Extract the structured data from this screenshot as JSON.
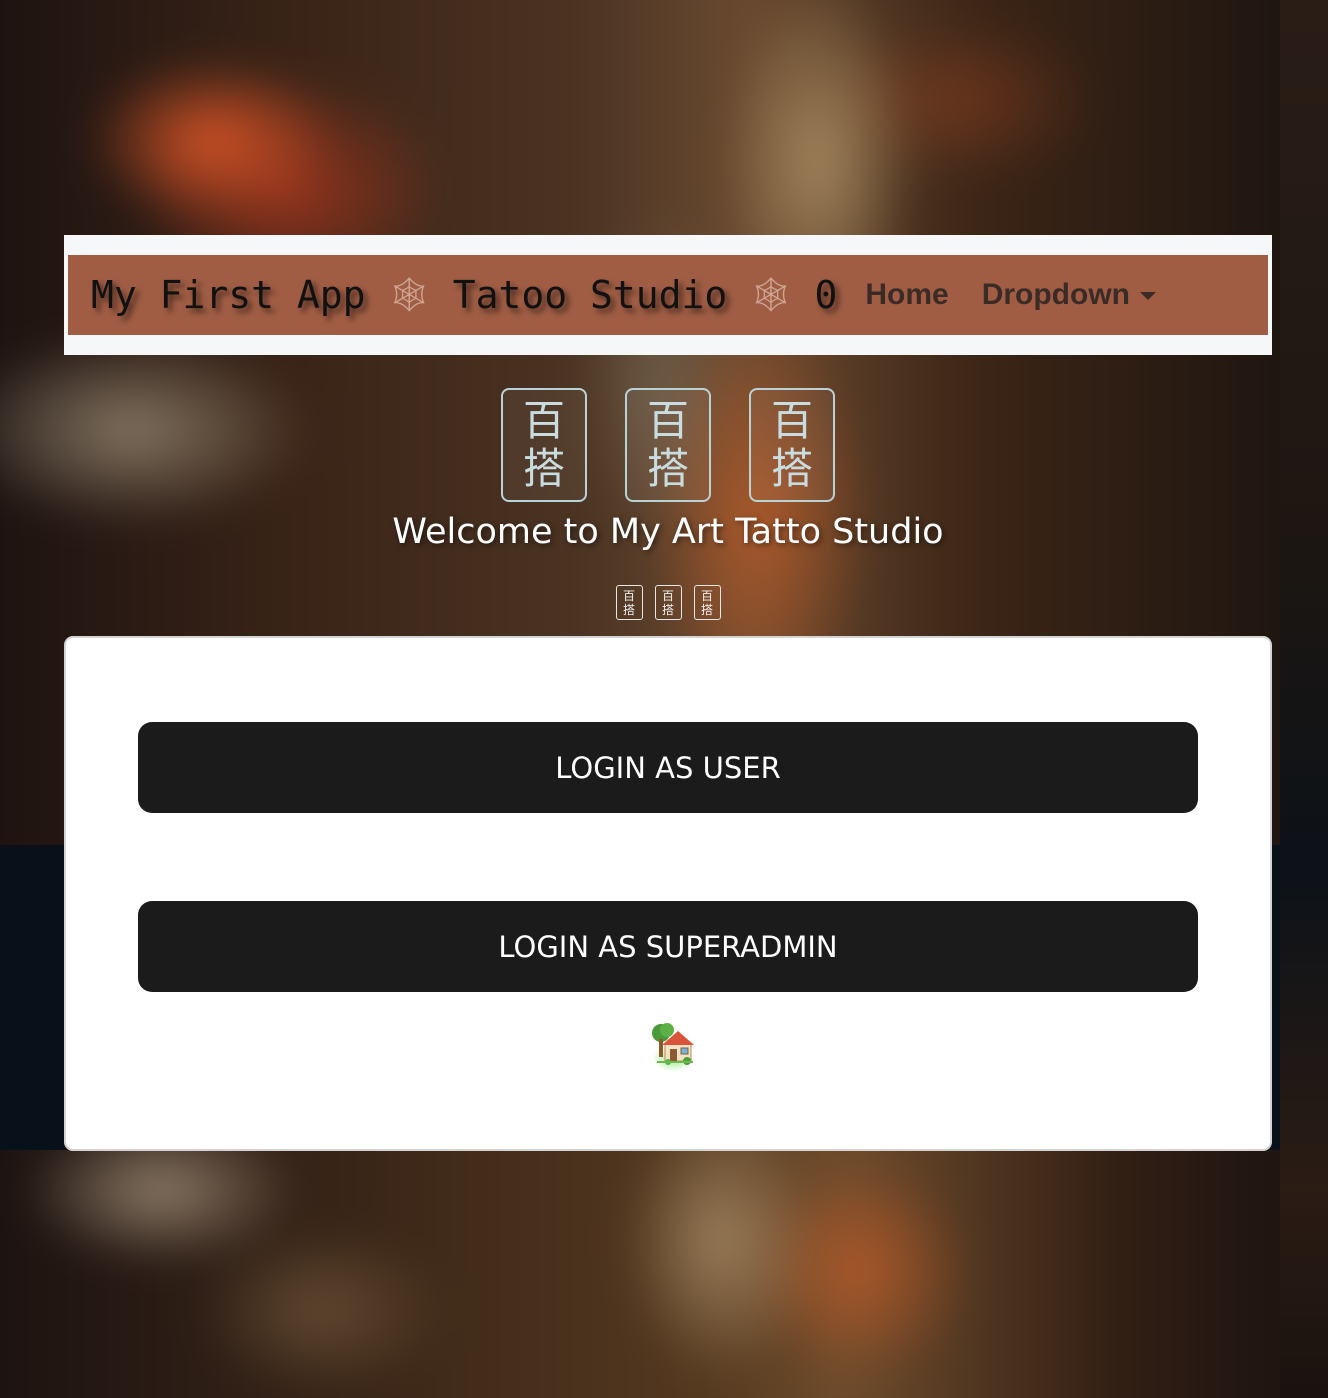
{
  "navbar": {
    "brand_part1": "My First App",
    "brand_part2": "Tatoo Studio",
    "brand_counter": "0",
    "separator_icon": "🕸",
    "links": [
      {
        "label": "Home"
      },
      {
        "label": "Dropdown"
      }
    ]
  },
  "hero": {
    "icon_tiles": [
      {
        "top": "百",
        "bottom": "搭"
      },
      {
        "top": "百",
        "bottom": "搭"
      },
      {
        "top": "百",
        "bottom": "搭"
      }
    ],
    "welcome_text": "Welcome to My Art Tatto Studio",
    "small_icon_tiles": [
      {
        "top": "百",
        "bottom": "搭"
      },
      {
        "top": "百",
        "bottom": "搭"
      },
      {
        "top": "百",
        "bottom": "搭"
      }
    ]
  },
  "login_card": {
    "user_button_label": "LOGIN AS USER",
    "superadmin_button_label": "LOGIN AS SUPERADMIN",
    "home_icon": "house-with-garden-icon"
  },
  "colors": {
    "navbar_bg": "#a05d44",
    "navbar_outer_bg": "#f6f7f9",
    "button_bg": "#1b1b1b",
    "card_bg": "#ffffff"
  }
}
